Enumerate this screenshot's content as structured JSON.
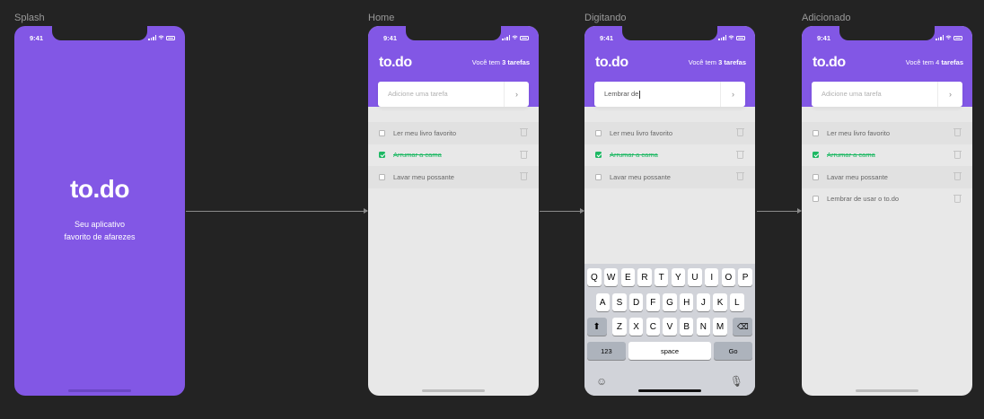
{
  "frames": [
    {
      "label": "Splash"
    },
    {
      "label": "Home"
    },
    {
      "label": "Digitando"
    },
    {
      "label": "Adicionado"
    }
  ],
  "status_time": "9:41",
  "app_name": "to.do",
  "splash": {
    "tagline_line1": "Seu aplicativo",
    "tagline_line2": "favorito de afarezes"
  },
  "header": {
    "counter_prefix": "Você tem",
    "counter_3": "3 tarefas",
    "counter_4_num": "4",
    "counter_4_word": "tarefas"
  },
  "input": {
    "placeholder": "Adicione uma tarefa",
    "typed_value": "Lembrar de",
    "submit_icon": "chevron-right-icon"
  },
  "tasks": {
    "t1": "Ler meu livro favorito",
    "t2": "Arrumar a cama",
    "t3": "Lavar meu possante",
    "t4": "Lembrar de usar o to.do"
  },
  "keyboard": {
    "row1": [
      "Q",
      "W",
      "E",
      "R",
      "T",
      "Y",
      "U",
      "I",
      "O",
      "P"
    ],
    "row2": [
      "A",
      "S",
      "D",
      "F",
      "G",
      "H",
      "J",
      "K",
      "L"
    ],
    "row3": [
      "Z",
      "X",
      "C",
      "V",
      "B",
      "N",
      "M"
    ],
    "numbers": "123",
    "space": "space",
    "go": "Go",
    "shift_icon": "shift-icon",
    "backspace_icon": "backspace-icon",
    "emoji_icon": "emoji-icon",
    "mic_icon": "microphone-icon"
  },
  "colors": {
    "brand": "#8257e5",
    "done": "#1db863",
    "background": "#232323"
  }
}
